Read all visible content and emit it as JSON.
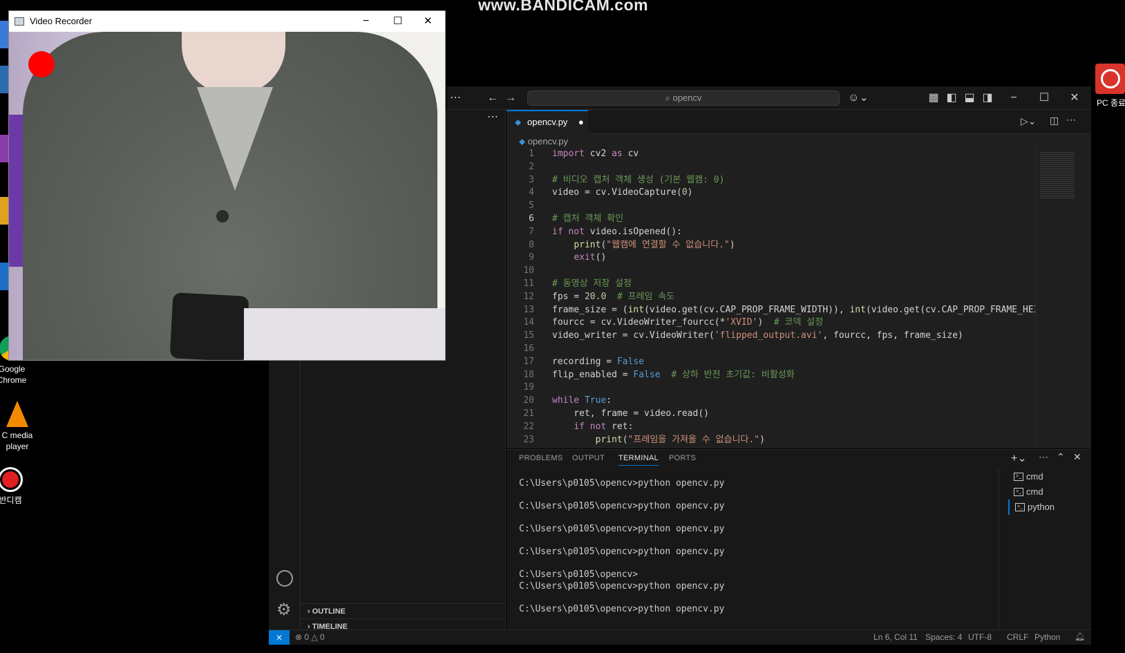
{
  "watermark": "www.BANDICAM.com",
  "desktop": {
    "icons": [
      {
        "label": "Google\nChrome",
        "name": "google-chrome"
      },
      {
        "label": "C media\nplayer",
        "name": "vlc-media-player"
      },
      {
        "label": "반디캠",
        "name": "bandicam"
      }
    ],
    "right_icon_label": "PC 종료"
  },
  "video_recorder": {
    "title": "Video Recorder",
    "recording_indicator_color": "#ff0000"
  },
  "vscode": {
    "search_placeholder": "opencv",
    "tab_label": "opencv.py",
    "breadcrumb": "opencv.py",
    "code_lines": [
      "import cv2 as cv",
      "",
      "# 비디오 캡처 객체 생성 (기본 웹캠: 0)",
      "video = cv.VideoCapture(0)",
      "",
      "# 캡처 객체 확인",
      "if not video.isOpened():",
      "    print(\"웹캠에 연결할 수 없습니다.\")",
      "    exit()",
      "",
      "# 동영상 저장 설정",
      "fps = 20.0  # 프레임 속도",
      "frame_size = (int(video.get(cv.CAP_PROP_FRAME_WIDTH)), int(video.get(cv.CAP_PROP_FRAME_HEIGH",
      "fourcc = cv.VideoWriter_fourcc(*'XVID')  # 코덱 설정",
      "video_writer = cv.VideoWriter('flipped_output.avi', fourcc, fps, frame_size)",
      "",
      "recording = False",
      "flip_enabled = False  # 상하 반전 초기값: 비활성화",
      "",
      "while True:",
      "    ret, frame = video.read()",
      "    if not ret:",
      "        print(\"프레임을 가져올 수 없습니다.\")"
    ],
    "panel_tabs": [
      "PROBLEMS",
      "OUTPUT",
      "TERMINAL",
      "PORTS"
    ],
    "active_panel_tab": "TERMINAL",
    "terminal_lines": [
      "C:\\Users\\p0105\\opencv>python opencv.py",
      "",
      "C:\\Users\\p0105\\opencv>python opencv.py",
      "",
      "C:\\Users\\p0105\\opencv>python opencv.py",
      "",
      "C:\\Users\\p0105\\opencv>python opencv.py",
      "",
      "C:\\Users\\p0105\\opencv>",
      "C:\\Users\\p0105\\opencv>python opencv.py",
      "",
      "C:\\Users\\p0105\\opencv>python opencv.py"
    ],
    "terminal_list": [
      "cmd",
      "cmd",
      "python"
    ],
    "sidebar_sections": [
      "OUTLINE",
      "TIMELINE"
    ],
    "status": {
      "errors": "0",
      "warnings": "0",
      "position": "Ln 6, Col 11",
      "spaces": "Spaces: 4",
      "encoding": "UTF-8",
      "eol": "CRLF",
      "language": "Python"
    }
  }
}
